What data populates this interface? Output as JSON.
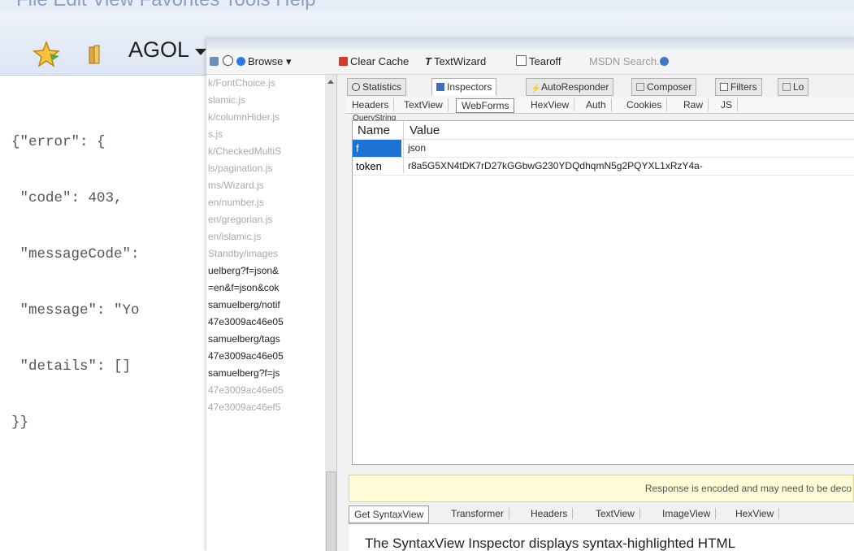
{
  "browser": {
    "menubar_text": "File  Edit  View  Favorites  Tools  Help",
    "favorites_bar": {
      "folder_label": "AGOL"
    }
  },
  "json_view": {
    "lines": [
      "{\"error\": {",
      " \"code\": 403,",
      " \"messageCode\":",
      " \"message\": \"Yo",
      " \"details\": []",
      "}}"
    ]
  },
  "fiddler": {
    "toolbar": {
      "browse": "Browse",
      "clear_cache": "Clear Cache",
      "textwizard": "TextWizard",
      "tearoff": "Tearoff",
      "msdn_search": "MSDN Search..."
    },
    "sessions": [
      {
        "text": "k/FontChoice.js",
        "dim": true
      },
      {
        "text": "slamic.js",
        "dim": true
      },
      {
        "text": "k/columnHider.js",
        "dim": true
      },
      {
        "text": "s.js",
        "dim": true
      },
      {
        "text": "k/CheckedMultiS",
        "dim": true
      },
      {
        "text": "ls/pagination.js",
        "dim": true
      },
      {
        "text": "ms/Wizard.js",
        "dim": true
      },
      {
        "text": "en/number.js",
        "dim": true
      },
      {
        "text": "en/gregorian.js",
        "dim": true
      },
      {
        "text": "en/islamic.js",
        "dim": true
      },
      {
        "text": "Standby/images",
        "dim": true
      },
      {
        "text": "uelberg?f=json&",
        "dim": false
      },
      {
        "text": "=en&f=json&cok",
        "dim": false
      },
      {
        "text": "samuelberg/notif",
        "dim": false
      },
      {
        "text": "47e3009ac46e05",
        "dim": false
      },
      {
        "text": "samuelberg/tags",
        "dim": false
      },
      {
        "text": "47e3009ac46e05",
        "dim": false
      },
      {
        "text": "samuelberg?f=js",
        "dim": false
      },
      {
        "text": "47e3009ac46e05",
        "dim": true
      },
      {
        "text": "47e3009ac46ef5",
        "dim": true
      }
    ],
    "inspector_tabs": [
      "Statistics",
      "Inspectors",
      "AutoResponder",
      "Composer",
      "Filters",
      "Lo"
    ],
    "request_subtabs": [
      "Headers",
      "TextView",
      "WebForms",
      "HexView",
      "Auth",
      "Cookies",
      "Raw",
      "JS"
    ],
    "querystring_label": "QueryString",
    "grid": {
      "headers": {
        "name": "Name",
        "value": "Value"
      },
      "rows": [
        {
          "name": "f",
          "value": "json",
          "selected": true
        },
        {
          "name": "token",
          "value": "r8a5G5XN4tDK7rD27kGGbwG230YDQdhqmN5g2PQYXL1xRzY4a-",
          "selected": false
        }
      ]
    },
    "response_notice": "Response is encoded and may need to be deco",
    "response_tabs": [
      "Get SyntaxView",
      "Transformer",
      "Headers",
      "TextView",
      "ImageView",
      "HexView"
    ],
    "response_body": "The SyntaxView Inspector displays syntax-highlighted HTML"
  },
  "colors": {
    "selection": "#1d72d6",
    "notice_bg": "#fffbd6"
  }
}
